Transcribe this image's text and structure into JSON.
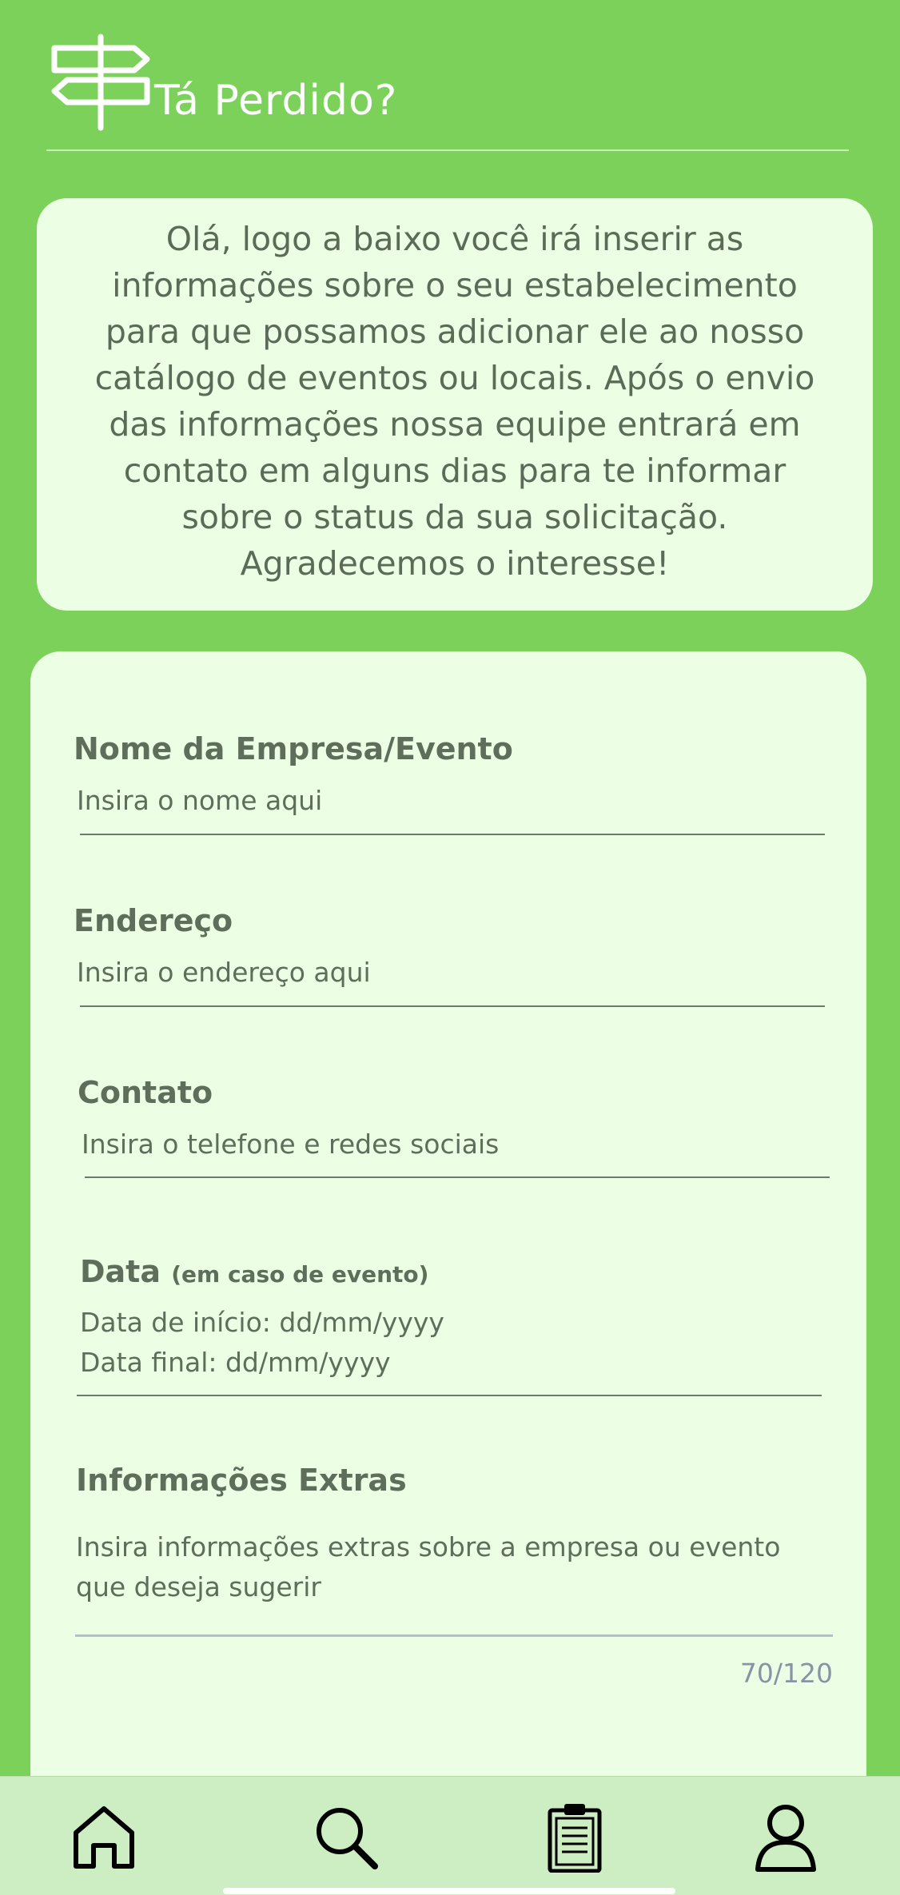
{
  "header": {
    "title": "Tá Perdido?",
    "logo_icon": "signpost-icon"
  },
  "intro": {
    "lines": [
      "Olá, logo a baixo você irá inserir as",
      "informações sobre o seu estabelecimento",
      "para que possamos adicionar ele ao nosso",
      "catálogo de eventos ou locais. Após o envio",
      "das informações nossa equipe entrará em",
      "contato em alguns dias para te informar",
      "sobre o status da sua solicitação.",
      "Agradecemos o interesse!"
    ]
  },
  "form": {
    "name": {
      "label": "Nome da Empresa/Evento",
      "placeholder": "Insira o nome aqui"
    },
    "address": {
      "label": "Endereço",
      "placeholder": "Insira o endereço aqui"
    },
    "contact": {
      "label": "Contato",
      "placeholder": "Insira o telefone e redes sociais"
    },
    "date": {
      "label": "Data",
      "label_note": "(em caso de evento)",
      "start": "Data de início: dd/mm/yyyy",
      "end": "Data final: dd/mm/yyyy"
    },
    "extras": {
      "label": "Informações Extras",
      "line1": "Insira informações extras sobre a empresa ou evento",
      "line2": "que deseja sugerir",
      "counter": "70/120"
    }
  },
  "nav": {
    "items": [
      {
        "icon": "home-icon"
      },
      {
        "icon": "search-icon"
      },
      {
        "icon": "clipboard-icon"
      },
      {
        "icon": "profile-icon"
      }
    ]
  },
  "colors": {
    "background": "#7cd15b",
    "card": "#ecffe5",
    "text": "#5e6e5b",
    "nav": "#cdedc2"
  }
}
